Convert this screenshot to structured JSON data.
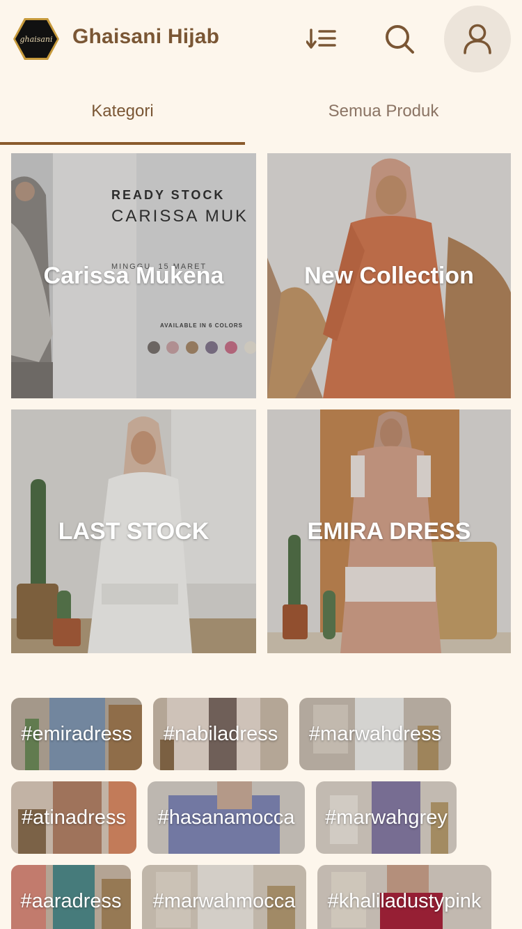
{
  "header": {
    "logo_text": "ghaisani",
    "brand_name": "Ghaisani Hijab"
  },
  "tabs": [
    {
      "label": "Kategori",
      "active": true
    },
    {
      "label": "Semua Produk",
      "active": false
    }
  ],
  "categories": [
    {
      "label": "Carissa Mukena",
      "banner_lines": [
        "READY STOCK",
        "CARISSA MUK",
        "MINGGU, 15 MARET",
        "AVAILABLE IN 6 COLORS"
      ]
    },
    {
      "label": "New Collection"
    },
    {
      "label": "LAST STOCK"
    },
    {
      "label": "EMIRA DRESS"
    }
  ],
  "hashtags": [
    {
      "label": "#emiradress"
    },
    {
      "label": "#nabiladress"
    },
    {
      "label": "#marwahdress"
    },
    {
      "label": "#atinadress"
    },
    {
      "label": "#hasanamocca"
    },
    {
      "label": "#marwahgrey"
    },
    {
      "label": "#aaradress"
    },
    {
      "label": "#marwahmocca"
    },
    {
      "label": "#khaliladustypink"
    }
  ],
  "colors": {
    "background": "#fdf6ec",
    "brand": "#7a5634",
    "tab_indicator": "#8a5a2c"
  }
}
